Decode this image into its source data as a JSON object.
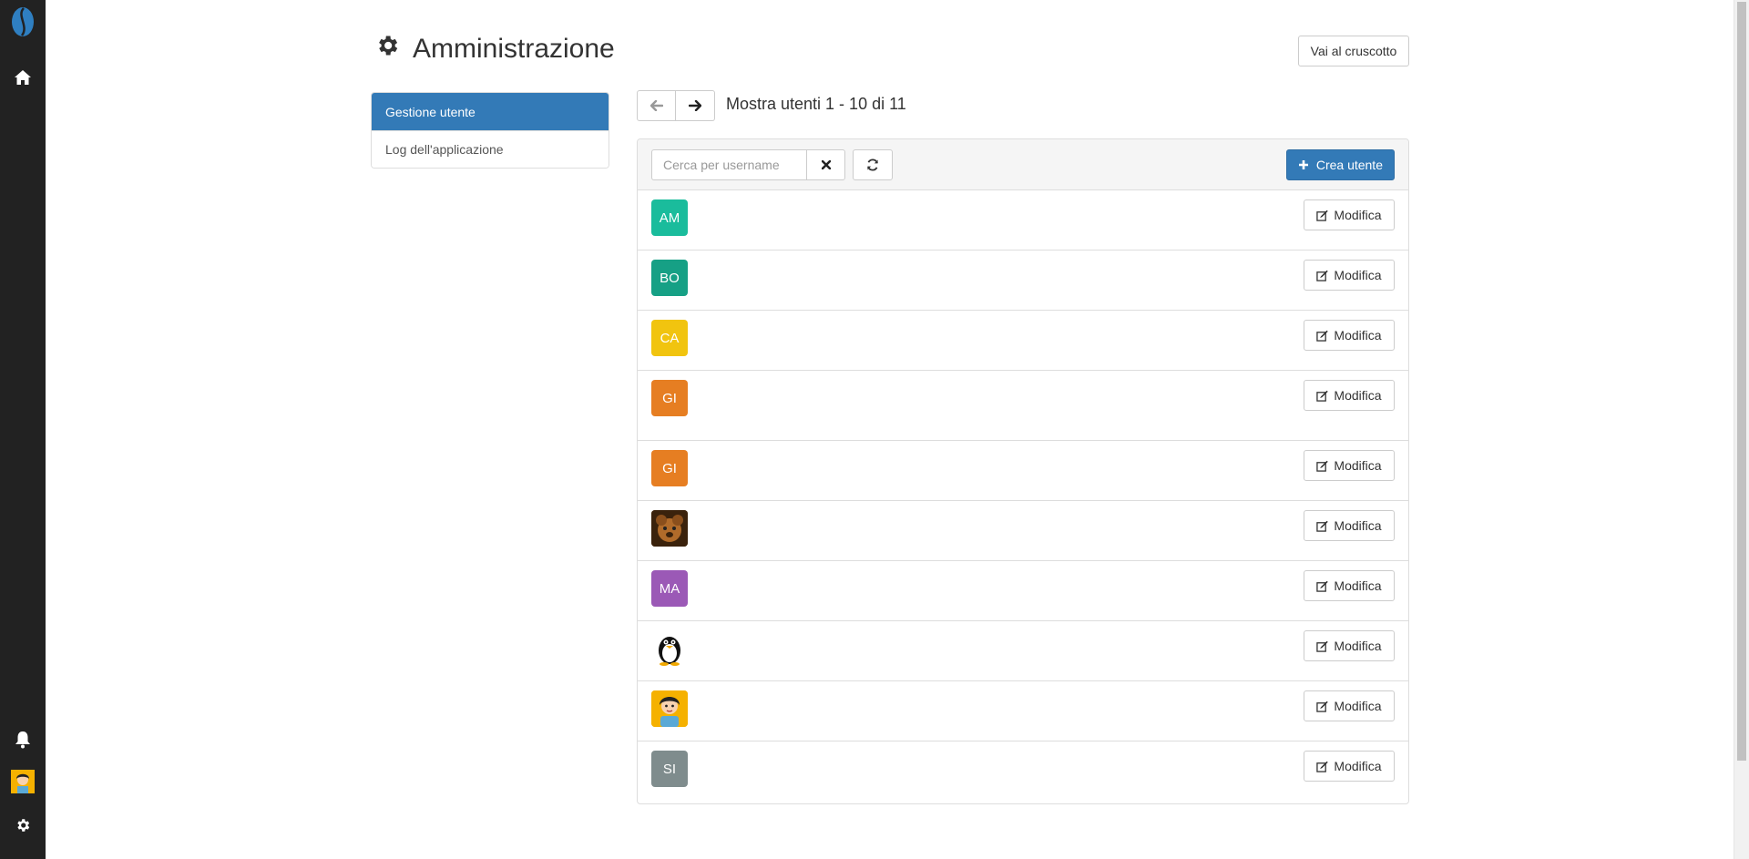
{
  "app": {
    "page_title": "Amministrazione",
    "dashboard_button": "Vai al cruscotto"
  },
  "icons": {
    "logo": "coffee-bean-logo-icon",
    "home": "home-icon",
    "bell": "bell-icon",
    "user": "user-avatar-icon",
    "settings": "gear-icon"
  },
  "colors": {
    "primary": "#337ab7",
    "sidebar": "#222222"
  },
  "nav": {
    "items": [
      {
        "label": "Gestione utente",
        "active": true
      },
      {
        "label": "Log dell'applicazione",
        "active": false
      }
    ]
  },
  "pager": {
    "text": "Mostra utenti 1 - 10 di 11"
  },
  "toolbar": {
    "search_placeholder": "Cerca per username",
    "search_value": "",
    "create_label": "Crea utente"
  },
  "users": [
    {
      "initials": "AM",
      "color": "#1abc9c",
      "type": "initials",
      "edit_label": "Modifica"
    },
    {
      "initials": "BO",
      "color": "#16a085",
      "type": "initials",
      "edit_label": "Modifica"
    },
    {
      "initials": "CA",
      "color": "#f1c40f",
      "type": "initials",
      "edit_label": "Modifica"
    },
    {
      "initials": "GI",
      "color": "#e67e22",
      "type": "initials",
      "edit_label": "Modifica"
    },
    {
      "initials": "GI",
      "color": "#e67e22",
      "type": "initials",
      "edit_label": "Modifica"
    },
    {
      "initials": "",
      "color": "#6b3e14",
      "type": "photo-dog",
      "edit_label": "Modifica"
    },
    {
      "initials": "MA",
      "color": "#9b59b6",
      "type": "initials",
      "edit_label": "Modifica"
    },
    {
      "initials": "",
      "color": "#ffffff",
      "type": "photo-penguin",
      "edit_label": "Modifica"
    },
    {
      "initials": "",
      "color": "#f5b100",
      "type": "photo-cartoon-person",
      "edit_label": "Modifica"
    },
    {
      "initials": "SI",
      "color": "#7f8c8d",
      "type": "initials",
      "edit_label": "Modifica"
    }
  ]
}
